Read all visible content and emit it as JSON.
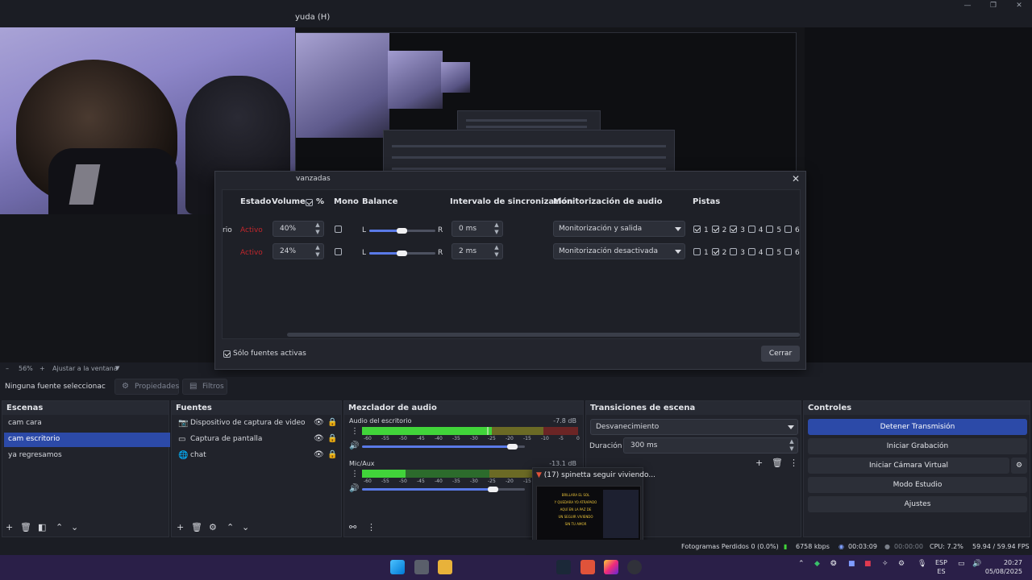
{
  "menu": {
    "help": "yuda (H)"
  },
  "preview": {
    "zoom": "56%",
    "fit_label": "Ajustar a la ventana",
    "minus": "–",
    "plus": "+"
  },
  "advanced_audio": {
    "title": "vanzadas",
    "headers": {
      "status": "Estado",
      "volume": "Volumen",
      "percent": "%",
      "mono": "Mono",
      "balance": "Balance",
      "sync": "Intervalo de sincronización",
      "monitoring": "Monitorización de audio",
      "tracks": "Pistas"
    },
    "rows": [
      {
        "name": "rio",
        "status": "Activo",
        "volume": "40%",
        "bal_l": "L",
        "bal_r": "R",
        "sync": "0 ms",
        "monitoring": "Monitorización y salida",
        "tracks": [
          {
            "n": "1",
            "on": true
          },
          {
            "n": "2",
            "on": true
          },
          {
            "n": "3",
            "on": true
          },
          {
            "n": "4",
            "on": false
          },
          {
            "n": "5",
            "on": false
          },
          {
            "n": "6",
            "on": false
          }
        ]
      },
      {
        "name": "",
        "status": "Activo",
        "volume": "24%",
        "bal_l": "L",
        "bal_r": "R",
        "sync": "2 ms",
        "monitoring": "Monitorización desactivada",
        "tracks": [
          {
            "n": "1",
            "on": false
          },
          {
            "n": "2",
            "on": true
          },
          {
            "n": "3",
            "on": false
          },
          {
            "n": "4",
            "on": false
          },
          {
            "n": "5",
            "on": false
          },
          {
            "n": "6",
            "on": false
          }
        ]
      }
    ],
    "active_only": "Sólo fuentes activas",
    "close_button": "Cerrar"
  },
  "source_toolbar": {
    "no_source": "Ninguna fuente seleccionac",
    "properties": "Propiedades",
    "filters": "Filtros"
  },
  "scenes": {
    "title": "Escenas",
    "items": [
      {
        "label": "cam cara",
        "selected": false
      },
      {
        "label": "cam escritorio",
        "selected": true
      },
      {
        "label": "ya regresamos",
        "selected": false
      }
    ]
  },
  "sources": {
    "title": "Fuentes",
    "items": [
      {
        "label": "Dispositivo de captura de video",
        "icon": "camera-icon"
      },
      {
        "label": "Captura de pantalla",
        "icon": "monitor-icon"
      },
      {
        "label": "chat",
        "icon": "globe-icon"
      }
    ]
  },
  "mixer": {
    "title": "Mezclador de audio",
    "channels": [
      {
        "name": "Audio del escritorio",
        "db": "-7.8 dB",
        "level": 0.6,
        "peak": 0.58,
        "volume": 0.92
      },
      {
        "name": "Mic/Aux",
        "db": "-13.1 dB",
        "level": 0.2,
        "peak": 0.0,
        "volume": 0.8
      }
    ],
    "scale": [
      "-60",
      "-55",
      "-50",
      "-45",
      "-40",
      "-35",
      "-30",
      "-25",
      "-20",
      "-15",
      "-10",
      "-5",
      "0"
    ]
  },
  "transitions": {
    "title": "Transiciones de escena",
    "selected": "Desvanecimiento",
    "duration_label": "Duración",
    "duration_value": "300 ms"
  },
  "controls": {
    "title": "Controles",
    "stop_stream": "Detener Transmisión",
    "start_recording": "Iniciar Grabación",
    "virtual_camera": "Iniciar Cámara Virtual",
    "studio_mode": "Modo Estudio",
    "settings": "Ajustes"
  },
  "statusbar": {
    "dropped": "Fotogramas Perdidos 0 (0.0%)",
    "bitrate": "6758 kbps",
    "stream_time": "00:03:09",
    "rec_time": "00:00:00",
    "cpu": "CPU: 7.2%",
    "fps": "59.94 / 59.94 FPS"
  },
  "notification": {
    "title": "(17) spinetta seguir viviendo...",
    "thumb_lines": [
      "BRILLARA EL SOL",
      "Y QUEDARA YO ATRAPADO",
      "AQUÍ EN LA PAZ DE",
      "UN SEGUIR VIVIENDO",
      "SIN TU AMOR"
    ]
  },
  "taskbar": {
    "lang_top": "ESP",
    "lang_bottom": "ES",
    "time": "20:27",
    "date": "05/08/2025"
  },
  "colors": {
    "accent": "#2c4aa8",
    "status_red": "#c2262c",
    "taskbar": "#2a1f48"
  }
}
